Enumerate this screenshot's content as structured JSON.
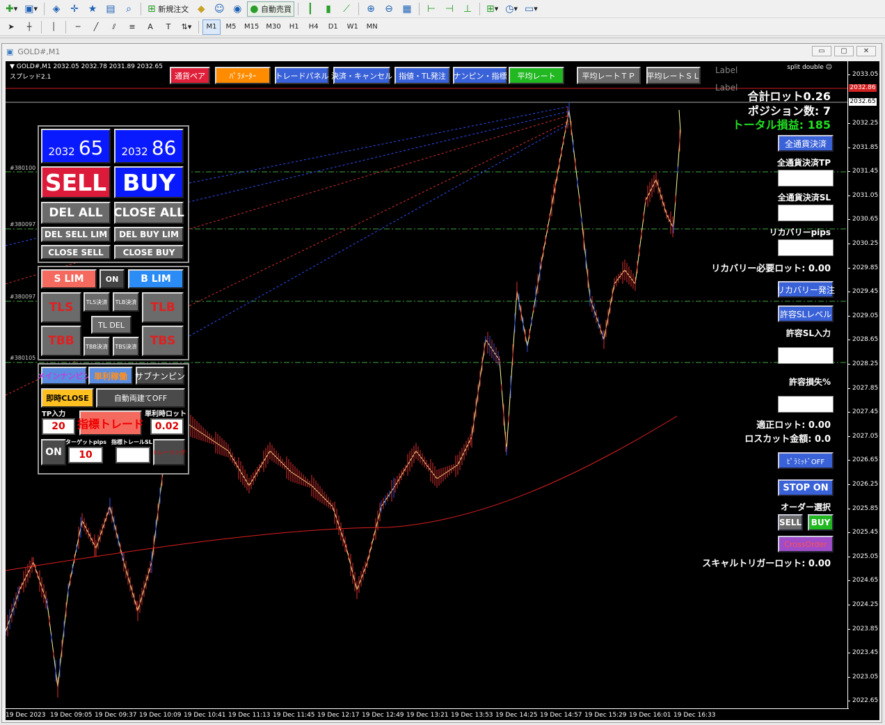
{
  "toolbar1": {
    "new_order": "新規注文",
    "auto_trade": "自動売買"
  },
  "toolbar2": {
    "timeframes": [
      "M1",
      "M5",
      "M15",
      "M30",
      "H1",
      "H4",
      "D1",
      "W1",
      "MN"
    ],
    "active_timeframe": "M1"
  },
  "window": {
    "title": "GOLD#,M1"
  },
  "chart": {
    "ohlc": "▼ GOLD#,M1  2032.05 2032.78 2031.89 2032.65",
    "spread": "スプレッド2.1",
    "split_double": "split double ☺",
    "label1": "Label",
    "label2": "Label",
    "price_ticks": [
      "2033.05",
      "2032.25",
      "2031.85",
      "2031.45",
      "2031.05",
      "2030.65",
      "2030.25",
      "2029.85",
      "2029.45",
      "2029.05",
      "2028.65",
      "2028.25",
      "2027.85",
      "2027.45",
      "2027.05",
      "2026.65",
      "2026.25",
      "2025.85",
      "2025.45",
      "2025.05",
      "2024.65",
      "2024.25",
      "2023.85",
      "2023.45",
      "2023.05",
      "2022.65"
    ],
    "ask_tag": "2032.86",
    "bid_tag": "2032.65",
    "time_ticks": [
      "19 Dec 2023",
      "19 Dec 09:05",
      "19 Dec 09:37",
      "19 Dec 10:09",
      "19 Dec 10:41",
      "19 Dec 11:13",
      "19 Dec 11:45",
      "19 Dec 12:17",
      "19 Dec 12:49",
      "19 Dec 13:21",
      "19 Dec 13:53",
      "19 Dec 14:25",
      "19 Dec 14:57",
      "19 Dec 15:29",
      "19 Dec 16:01",
      "19 Dec 16:33"
    ],
    "account_labels": [
      "#380100",
      "#380097",
      "#380097",
      "#380105"
    ]
  },
  "topbar": [
    {
      "label": "通貨ペア",
      "bg": "#e0203a",
      "fg": "#ffffff"
    },
    {
      "label": "ﾊﾟﾗﾒｰﾀｰ",
      "bg": "#ff8c00",
      "fg": "#ffffff"
    },
    {
      "label": "トレードパネル",
      "bg": "#3a62d8",
      "fg": "#ffffff"
    },
    {
      "label": "決済・キャンセル",
      "bg": "#3a62d8",
      "fg": "#ffffff"
    },
    {
      "label": "指値・TL発注",
      "bg": "#3a62d8",
      "fg": "#ffffff"
    },
    {
      "label": "ナンピン・指標",
      "bg": "#3a62d8",
      "fg": "#ffffff"
    },
    {
      "label": "平均レート",
      "bg": "#22b822",
      "fg": "#ffffff"
    },
    {
      "label": "平均レートＴＰ",
      "bg": "#6b6b6b",
      "fg": "#ffffff"
    },
    {
      "label": "平均レートＳＬ",
      "bg": "#6b6b6b",
      "fg": "#ffffff"
    }
  ],
  "panel": {
    "bid_small": "2032",
    "bid_big": "65",
    "ask_small": "2032",
    "ask_big": "86",
    "sell": "SELL",
    "buy": "BUY",
    "del_all": "DEL ALL",
    "close_all": "CLOSE ALL",
    "del_sell_lim": "DEL SELL LIM",
    "del_buy_lim": "DEL BUY LIM",
    "close_sell": "CLOSE SELL",
    "close_buy": "CLOSE BUY",
    "s_lim": "S LIM",
    "on1": "ON",
    "b_lim": "B LIM",
    "tls": "TLS",
    "tls_close": "TLS決済",
    "tlb_close": "TLB決済",
    "tlb": "TLB",
    "tl_del": "TL DEL",
    "tbb": "TBB",
    "tbb_close": "TBB決済",
    "tbs_close": "TBS決済",
    "tbs": "TBS",
    "main_nanpin": "メインナンピン",
    "single_profit": "単利稼働",
    "sub_nanpin": "サブナンピン",
    "instant_close": "即時CLOSE",
    "auto_hedge": "自動両建てOFF",
    "tp_label": "TP入力",
    "tp_value": "20",
    "indicator_trade": "指標トレード",
    "lot_label": "単利時ロット",
    "lot_value": "0.02",
    "on2": "ON",
    "target_pips_label": "ターゲットpips",
    "target_pips_value": "10",
    "trail_sl_label": "指標トレールSL",
    "trailing": "トレーリング"
  },
  "right": {
    "total_lot": "合計ロット0.26",
    "positions": "ポジション数: 7",
    "total_pl": "トータル損益: 185",
    "close_all_ccy": "全通貨決済",
    "close_all_tp": "全通貨決済TP",
    "close_all_sl": "全通貨決済SL",
    "recovery_pips": "リカバリーpips",
    "recovery_lot": "リカバリー必要ロット: 0.00",
    "recovery_order": "リカバリー発注",
    "allow_sl_level": "許容SLレベル",
    "allow_sl_input": "許容SL入力",
    "allow_loss_pct": "許容損失%",
    "proper_lot": "適正ロット:  0.00",
    "losscut_amount": "ロスカット金額: 0.0",
    "pyramid_off": "ﾋﾟﾗﾐｯﾄﾞOFF",
    "stop_on": "STOP ON",
    "order_select": "オーダー選択",
    "sell": "SELL",
    "buy": "BUY",
    "cross_order": "CrossOrder",
    "scalp_trigger": "スキャルトリガーロット: 0.00"
  }
}
